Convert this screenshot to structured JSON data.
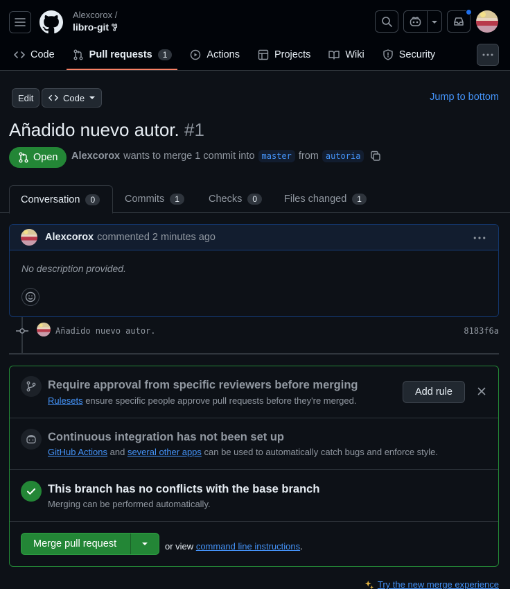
{
  "header": {
    "owner": "Alexcorox /",
    "repo": "libro-git"
  },
  "nav": {
    "items": [
      {
        "label": "Code"
      },
      {
        "label": "Pull requests",
        "count": "1"
      },
      {
        "label": "Actions"
      },
      {
        "label": "Projects"
      },
      {
        "label": "Wiki"
      },
      {
        "label": "Security"
      }
    ]
  },
  "toolbar": {
    "edit_label": "Edit",
    "code_label": "Code",
    "jump_label": "Jump to bottom"
  },
  "pr": {
    "title": "Añadido nuevo autor.",
    "number": "#1",
    "state": "Open",
    "author": "Alexcorox",
    "merge_text": "wants to merge 1 commit into",
    "base_branch": "master",
    "from_text": "from",
    "head_branch": "autoria"
  },
  "tabs": [
    {
      "label": "Conversation",
      "count": "0"
    },
    {
      "label": "Commits",
      "count": "1"
    },
    {
      "label": "Checks",
      "count": "0"
    },
    {
      "label": "Files changed",
      "count": "1"
    }
  ],
  "comment": {
    "author": "Alexcorox",
    "action": "commented 2 minutes ago",
    "body": "No description provided."
  },
  "commit": {
    "message": "Añadido nuevo autor.",
    "sha": "8183f6a"
  },
  "mergebox": {
    "rules_title": "Require approval from specific reviewers before merging",
    "rules_link": "Rulesets",
    "rules_sub": "ensure specific people approve pull requests before they're merged.",
    "add_rule_label": "Add rule",
    "ci_title": "Continuous integration has not been set up",
    "ci_link1": "GitHub Actions",
    "ci_and": "and",
    "ci_link2": "several other apps",
    "ci_sub": "can be used to automatically catch bugs and enforce style.",
    "conflict_title": "This branch has no conflicts with the base branch",
    "conflict_sub": "Merging can be performed automatically.",
    "merge_label": "Merge pull request",
    "or_view": "or view",
    "cli_link": "command line instructions",
    "period": "."
  },
  "footer": {
    "try_new": "Try the new merge experience"
  }
}
